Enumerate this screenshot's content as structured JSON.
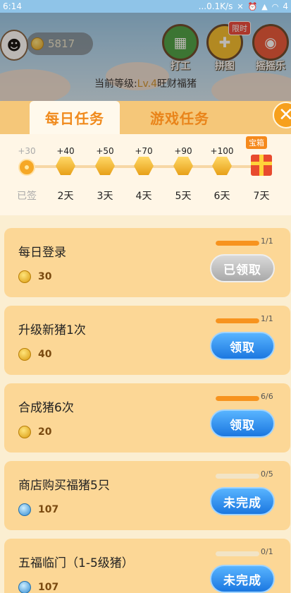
{
  "status_bar": {
    "time": "6:14",
    "network": "...0.1K/s",
    "icons": [
      "mute-icon",
      "alarm-icon",
      "hd-signal-icon",
      "wifi-icon"
    ],
    "battery": "4"
  },
  "header": {
    "coins": "5817",
    "level_prefix": "当前等级:",
    "level_value": "Lv.4",
    "level_name": "旺财福猪",
    "buttons": [
      {
        "label": "打工",
        "icon": "calendar-icon",
        "color": "#3c9a3a"
      },
      {
        "label": "拼图",
        "icon": "puzzle-icon",
        "color": "#f2b81f",
        "badge": "限时"
      },
      {
        "label": "摇摇乐",
        "icon": "claim-badge-icon",
        "color": "#e34a2c"
      }
    ]
  },
  "tabs": {
    "daily": "每日任务",
    "game": "游戏任务",
    "active": "daily"
  },
  "signin": {
    "chest_tag": "宝箱",
    "days": [
      {
        "bonus": "+30",
        "label": "已签",
        "done": true
      },
      {
        "bonus": "+40",
        "label": "2天"
      },
      {
        "bonus": "+50",
        "label": "3天"
      },
      {
        "bonus": "+70",
        "label": "4天"
      },
      {
        "bonus": "+90",
        "label": "5天"
      },
      {
        "bonus": "+100",
        "label": "6天"
      },
      {
        "bonus": "",
        "label": "7天",
        "chest": true
      }
    ]
  },
  "tasks": [
    {
      "name": "每日登录",
      "reward": "30",
      "reward_icon": "coin-icon",
      "progress": "1/1",
      "fraction": 1,
      "button": "已领取",
      "state": "claimed"
    },
    {
      "name": "升级新猪1次",
      "reward": "40",
      "reward_icon": "coin-icon",
      "progress": "1/1",
      "fraction": 1,
      "button": "领取",
      "state": "claim"
    },
    {
      "name": "合成猪6次",
      "reward": "20",
      "reward_icon": "coin-icon",
      "progress": "6/6",
      "fraction": 1,
      "button": "领取",
      "state": "claim"
    },
    {
      "name": "商店购买福猪5只",
      "reward": "107",
      "reward_icon": "gem-icon",
      "progress": "0/5",
      "fraction": 0,
      "button": "未完成",
      "state": "incomplete"
    },
    {
      "name": "五福临门（1-5级猪）",
      "reward": "107",
      "reward_icon": "gem-icon",
      "progress": "0/1",
      "fraction": 0,
      "button": "未完成",
      "state": "incomplete"
    }
  ],
  "colors": {
    "accent_orange": "#f7931e",
    "claim_blue": "#1b77e0",
    "claimed_gray": "#a9a9a9"
  }
}
